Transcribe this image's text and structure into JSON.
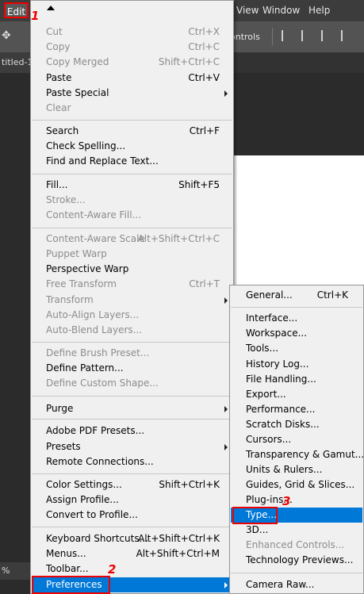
{
  "menubar": {
    "edit": "Edit",
    "view": "View",
    "window": "Window",
    "help": "Help"
  },
  "options_bar": {
    "controls_label": "ontrols"
  },
  "tab": {
    "label": "titled-1"
  },
  "status": {
    "zoom": "%"
  },
  "edit_menu": {
    "items": [
      {
        "label": "Cut",
        "shortcut": "Ctrl+X",
        "disabled": true
      },
      {
        "label": "Copy",
        "shortcut": "Ctrl+C",
        "disabled": true
      },
      {
        "label": "Copy Merged",
        "shortcut": "Shift+Ctrl+C",
        "disabled": true
      },
      {
        "label": "Paste",
        "shortcut": "Ctrl+V",
        "disabled": false
      },
      {
        "label": "Paste Special",
        "shortcut": "",
        "disabled": false,
        "submenu": true
      },
      {
        "label": "Clear",
        "shortcut": "",
        "disabled": true
      },
      {
        "label": "Search",
        "shortcut": "Ctrl+F",
        "disabled": false
      },
      {
        "label": "Check Spelling...",
        "shortcut": "",
        "disabled": false
      },
      {
        "label": "Find and Replace Text...",
        "shortcut": "",
        "disabled": false
      },
      {
        "label": "Fill...",
        "shortcut": "Shift+F5",
        "disabled": false
      },
      {
        "label": "Stroke...",
        "shortcut": "",
        "disabled": true
      },
      {
        "label": "Content-Aware Fill...",
        "shortcut": "",
        "disabled": true
      },
      {
        "label": "Content-Aware Scale",
        "shortcut": "Alt+Shift+Ctrl+C",
        "disabled": true
      },
      {
        "label": "Puppet Warp",
        "shortcut": "",
        "disabled": true
      },
      {
        "label": "Perspective Warp",
        "shortcut": "",
        "disabled": false
      },
      {
        "label": "Free Transform",
        "shortcut": "Ctrl+T",
        "disabled": true
      },
      {
        "label": "Transform",
        "shortcut": "",
        "disabled": true,
        "submenu": true
      },
      {
        "label": "Auto-Align Layers...",
        "shortcut": "",
        "disabled": true
      },
      {
        "label": "Auto-Blend Layers...",
        "shortcut": "",
        "disabled": true
      },
      {
        "label": "Define Brush Preset...",
        "shortcut": "",
        "disabled": true
      },
      {
        "label": "Define Pattern...",
        "shortcut": "",
        "disabled": false
      },
      {
        "label": "Define Custom Shape...",
        "shortcut": "",
        "disabled": true
      },
      {
        "label": "Purge",
        "shortcut": "",
        "disabled": false,
        "submenu": true
      },
      {
        "label": "Adobe PDF Presets...",
        "shortcut": "",
        "disabled": false
      },
      {
        "label": "Presets",
        "shortcut": "",
        "disabled": false,
        "submenu": true
      },
      {
        "label": "Remote Connections...",
        "shortcut": "",
        "disabled": false
      },
      {
        "label": "Color Settings...",
        "shortcut": "Shift+Ctrl+K",
        "disabled": false
      },
      {
        "label": "Assign Profile...",
        "shortcut": "",
        "disabled": false
      },
      {
        "label": "Convert to Profile...",
        "shortcut": "",
        "disabled": false
      },
      {
        "label": "Keyboard Shortcuts...",
        "shortcut": "Alt+Shift+Ctrl+K",
        "disabled": false
      },
      {
        "label": "Menus...",
        "shortcut": "Alt+Shift+Ctrl+M",
        "disabled": false
      },
      {
        "label": "Toolbar...",
        "shortcut": "",
        "disabled": false
      },
      {
        "label": "Preferences",
        "shortcut": "",
        "disabled": false,
        "submenu": true,
        "highlighted": true
      }
    ]
  },
  "preferences_menu": {
    "items": [
      {
        "label": "General...",
        "shortcut": "Ctrl+K",
        "disabled": false
      },
      {
        "label": "Interface...",
        "shortcut": "",
        "disabled": false
      },
      {
        "label": "Workspace...",
        "shortcut": "",
        "disabled": false
      },
      {
        "label": "Tools...",
        "shortcut": "",
        "disabled": false
      },
      {
        "label": "History Log...",
        "shortcut": "",
        "disabled": false
      },
      {
        "label": "File Handling...",
        "shortcut": "",
        "disabled": false
      },
      {
        "label": "Export...",
        "shortcut": "",
        "disabled": false
      },
      {
        "label": "Performance...",
        "shortcut": "",
        "disabled": false
      },
      {
        "label": "Scratch Disks...",
        "shortcut": "",
        "disabled": false
      },
      {
        "label": "Cursors...",
        "shortcut": "",
        "disabled": false
      },
      {
        "label": "Transparency & Gamut...",
        "shortcut": "",
        "disabled": false
      },
      {
        "label": "Units & Rulers...",
        "shortcut": "",
        "disabled": false
      },
      {
        "label": "Guides, Grid & Slices...",
        "shortcut": "",
        "disabled": false
      },
      {
        "label": "Plug-ins...",
        "shortcut": "",
        "disabled": false
      },
      {
        "label": "Type...",
        "shortcut": "",
        "disabled": false,
        "highlighted": true
      },
      {
        "label": "3D...",
        "shortcut": "",
        "disabled": false
      },
      {
        "label": "Enhanced Controls...",
        "shortcut": "",
        "disabled": true
      },
      {
        "label": "Technology Previews...",
        "shortcut": "",
        "disabled": false
      },
      {
        "label": "Camera Raw...",
        "shortcut": "",
        "disabled": false
      }
    ]
  },
  "annotations": {
    "one": "1",
    "two": "2",
    "three": "3"
  },
  "colors": {
    "highlight": "#0078d7",
    "annotation": "#e00000"
  }
}
